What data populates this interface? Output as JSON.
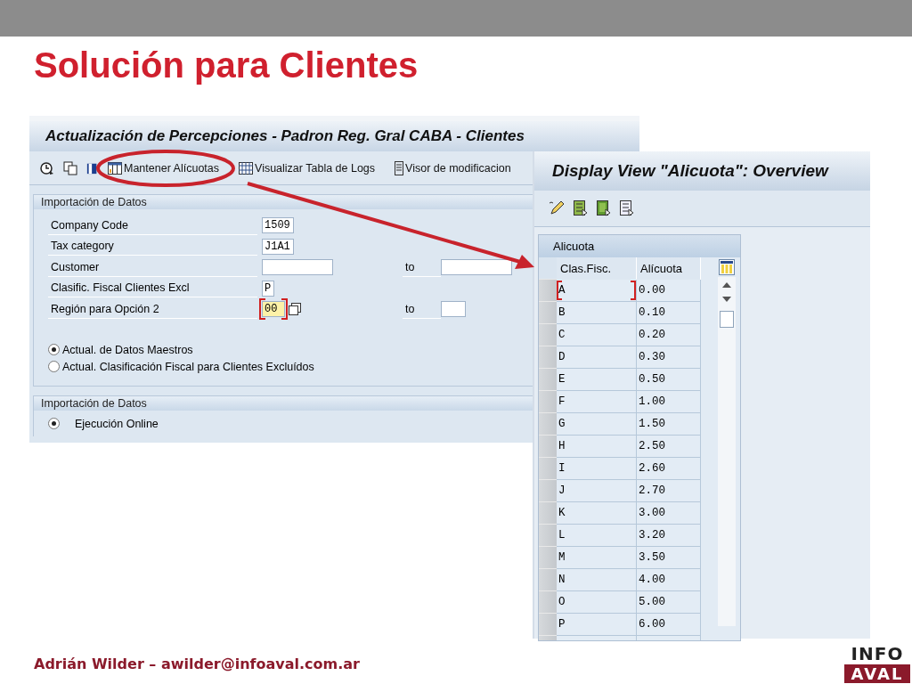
{
  "slide": {
    "title": "Solución para Clientes",
    "footer": "Adrián Wilder – awilder@infoaval.com.ar",
    "logo": {
      "line_1": "INFO",
      "line_2": "AVAL"
    }
  },
  "left_window": {
    "title": "Actualización de Percepciones - Padron Reg. Gral CABA - Clientes",
    "toolbar": [
      {
        "kind": "table",
        "label": "Mantener Alícuotas"
      },
      {
        "kind": "grid",
        "label": "Visualizar Tabla de Logs"
      },
      {
        "kind": "document",
        "label": "Visor de modificacion"
      }
    ],
    "group_1": {
      "title": "Importación de Datos",
      "fields": [
        {
          "label": "Company Code",
          "value": "1509",
          "focused": false
        },
        {
          "label": "Tax category",
          "value": "J1A1",
          "focused": false
        },
        {
          "label": "Customer",
          "focused": false,
          "to_label": "to"
        },
        {
          "label": "Clasific. Fiscal Clientes Excl",
          "value": "P",
          "focused": false
        },
        {
          "label": "Región para Opción 2",
          "value": "00",
          "focused": true,
          "to_label": "to"
        }
      ],
      "options": [
        {
          "label": "Actual. de Datos Maestros",
          "selected": true
        },
        {
          "label": "Actual. Clasificación Fiscal para Clientes Excluídos",
          "selected": false
        }
      ]
    },
    "group_2": {
      "title": "Importación de Datos",
      "options": [
        {
          "label": "Ejecución Online",
          "selected": true
        }
      ]
    }
  },
  "right_window": {
    "title": "Display View \"Alicuota\": Overview",
    "table": {
      "title": "Alicuota",
      "columns": [
        "Clas.Fisc.",
        "Alícuota"
      ],
      "rows": [
        {
          "cells": [
            "A",
            "0.00"
          ],
          "focused": true
        },
        {
          "cells": [
            "B",
            "0.10"
          ],
          "focused": false
        },
        {
          "cells": [
            "C",
            "0.20"
          ],
          "focused": false
        },
        {
          "cells": [
            "D",
            "0.30"
          ],
          "focused": false
        },
        {
          "cells": [
            "E",
            "0.50"
          ],
          "focused": false
        },
        {
          "cells": [
            "F",
            "1.00"
          ],
          "focused": false
        },
        {
          "cells": [
            "G",
            "1.50"
          ],
          "focused": false
        },
        {
          "cells": [
            "H",
            "2.50"
          ],
          "focused": false
        },
        {
          "cells": [
            "I",
            "2.60"
          ],
          "focused": false
        },
        {
          "cells": [
            "J",
            "2.70"
          ],
          "focused": false
        },
        {
          "cells": [
            "K",
            "3.00"
          ],
          "focused": false
        },
        {
          "cells": [
            "L",
            "3.20"
          ],
          "focused": false
        },
        {
          "cells": [
            "M",
            "3.50"
          ],
          "focused": false
        },
        {
          "cells": [
            "N",
            "4.00"
          ],
          "focused": false
        },
        {
          "cells": [
            "O",
            "5.00"
          ],
          "focused": false
        },
        {
          "cells": [
            "P",
            "6.00"
          ],
          "focused": false
        }
      ]
    }
  }
}
